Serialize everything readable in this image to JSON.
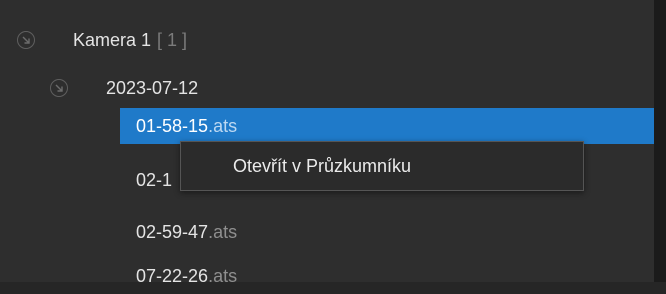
{
  "tree": {
    "camera": {
      "name": "Kamera 1",
      "count": "[ 1 ]",
      "icon": "collapse-icon"
    },
    "date": {
      "name": "2023-07-12",
      "icon": "collapse-icon"
    },
    "files": [
      {
        "base": "01-58-15",
        "ext": ".ats",
        "selected": true
      },
      {
        "base": "02-1",
        "ext": "",
        "selected": false
      },
      {
        "base": "02-59-47",
        "ext": ".ats",
        "selected": false
      },
      {
        "base": "07-22-26",
        "ext": ".ats",
        "selected": false
      }
    ]
  },
  "context_menu": {
    "items": [
      {
        "label": "Otevřít v Průzkumníku"
      }
    ]
  },
  "colors": {
    "background": "#2e2e2e",
    "selection": "#1f7ac9",
    "text": "#e4e4e4",
    "muted_text": "#8f8f8f"
  }
}
